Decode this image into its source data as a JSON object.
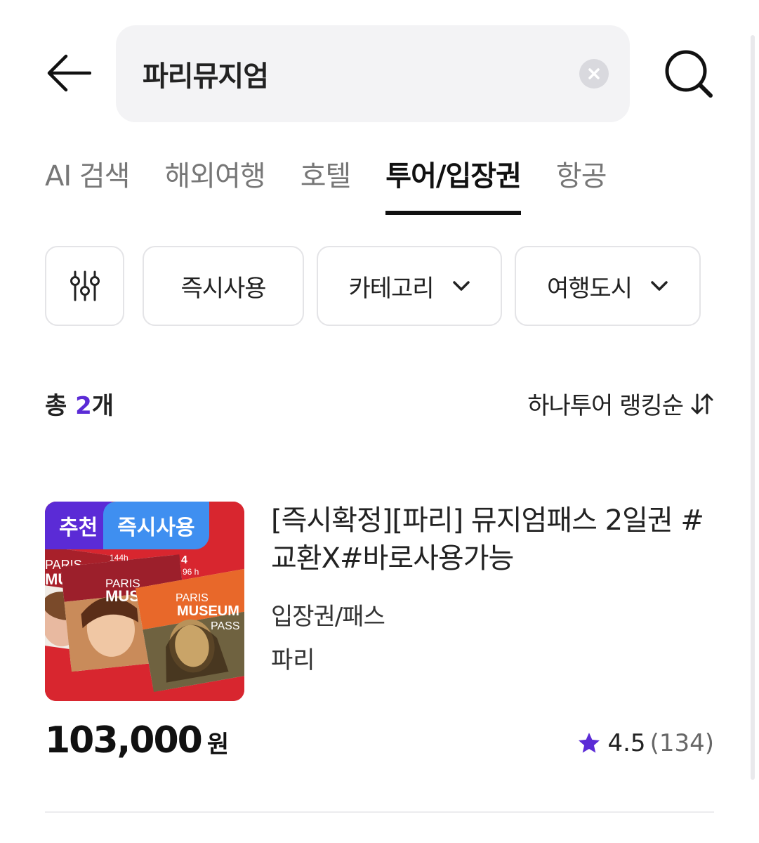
{
  "search": {
    "query": "파리뮤지엄"
  },
  "tabs": [
    {
      "label": "AI 검색",
      "active": false
    },
    {
      "label": "해외여행",
      "active": false
    },
    {
      "label": "호텔",
      "active": false
    },
    {
      "label": "투어/입장권",
      "active": true
    },
    {
      "label": "항공",
      "active": false
    }
  ],
  "filters": {
    "instant_label": "즉시사용",
    "category_label": "카테고리",
    "city_label": "여행도시"
  },
  "results": {
    "total_prefix": "총 ",
    "total_count": "2",
    "total_suffix": "개",
    "sort_label": "하나투어 랭킹순"
  },
  "product": {
    "badge_recommend": "추천",
    "badge_instant": "즉시사용",
    "title": "[즉시확정][파리] 뮤지엄패스 2일권 #교환X#바로사용가능",
    "category": "입장권/패스",
    "city": "파리",
    "price": "103,000",
    "price_unit": "원",
    "rating": "4.5",
    "review_count": "(134)",
    "image_text": {
      "card1_l1": "PARIS",
      "card1_l2": "MUS",
      "card2_l1": "PARIS",
      "card2_l2": "MUS",
      "card3_l1": "PARIS",
      "card3_l2": "MUSEUM",
      "card3_l3": "PASS",
      "hours_a": "144h",
      "hours_b": "4",
      "hours_c": "96 h"
    }
  },
  "colors": {
    "accent": "#5b2bd6",
    "instant_badge": "#3f8ff0",
    "image_red": "#d8262f"
  }
}
